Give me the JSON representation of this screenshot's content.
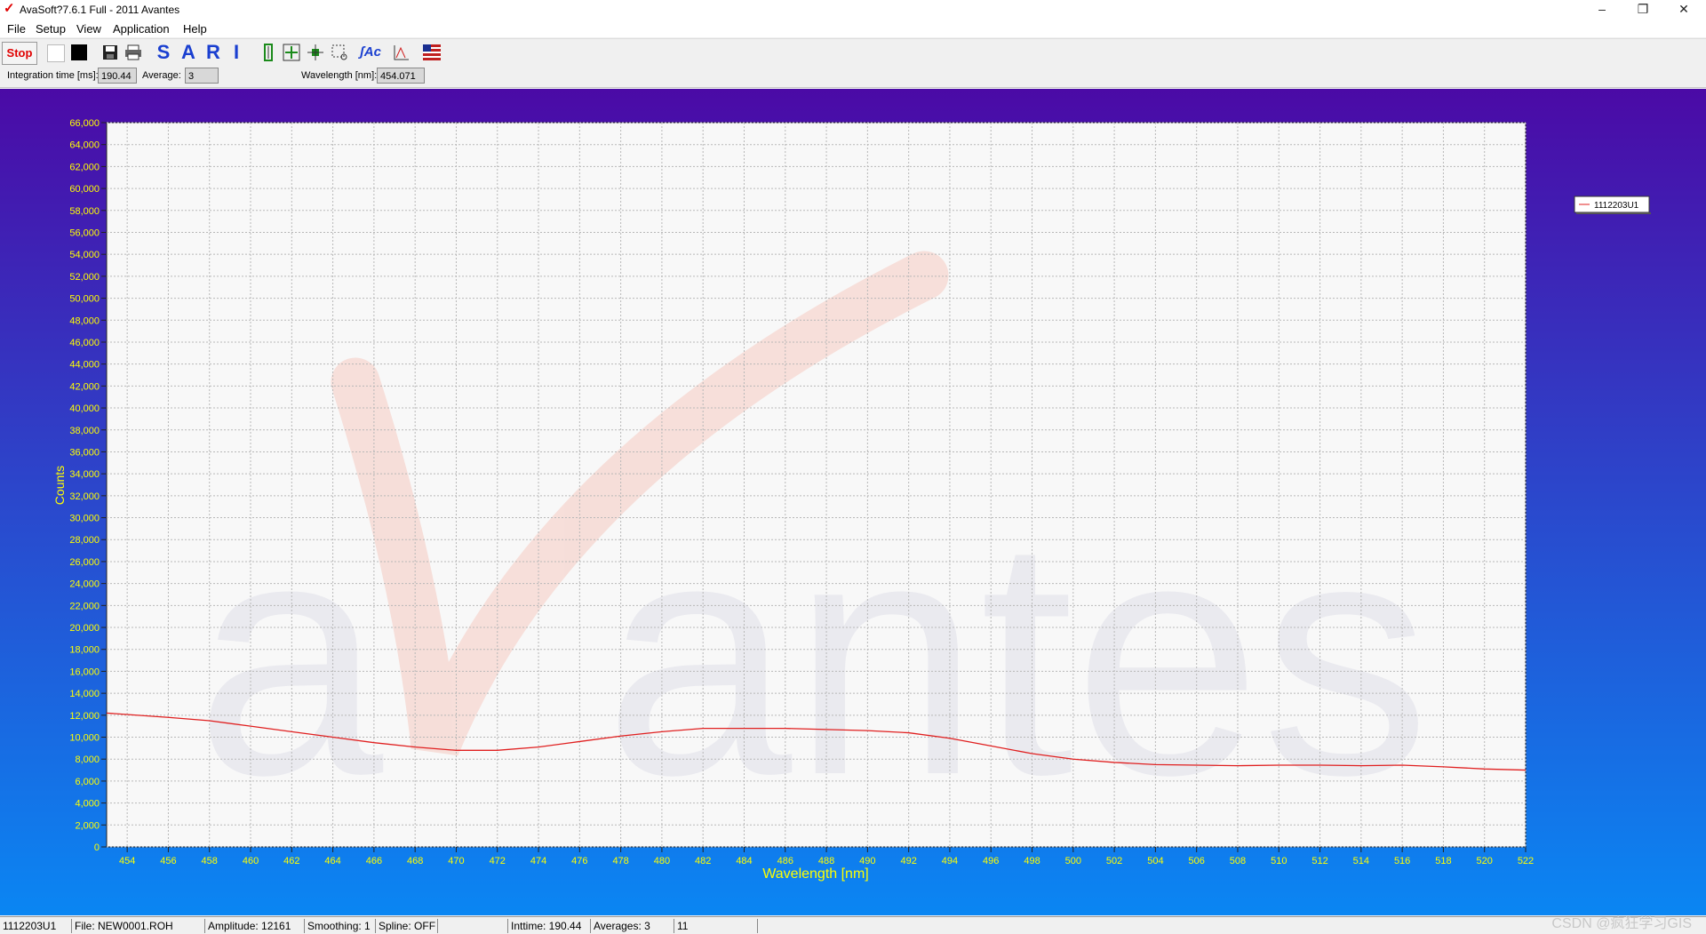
{
  "window": {
    "title": "AvaSoft?7.6.1 Full - 2011 Avantes",
    "minimize": "–",
    "maximize": "❐",
    "close": "✕"
  },
  "menu": [
    "File",
    "Setup",
    "View",
    "Application",
    "Help"
  ],
  "toolbar": {
    "stop_label": "Stop",
    "letters": [
      "S",
      "A",
      "R",
      "I"
    ],
    "icons": [
      "white-box-icon",
      "black-box-icon",
      "save-icon",
      "print-icon",
      "scope-mode-s-icon",
      "absorbance-mode-a-icon",
      "reflectance-mode-r-icon",
      "irradiance-mode-i-icon",
      "cursor-icon",
      "autoscale-icon",
      "zoom-icon",
      "zoom-rect-icon",
      "fit-icon",
      "peak-icon",
      "flag-icon"
    ]
  },
  "params": {
    "integration_label": "Integration time [ms]:",
    "integration_value": "190.44",
    "average_label": "Average:",
    "average_value": "3",
    "wavelength_label": "Wavelength [nm]:",
    "wavelength_value": "454.071"
  },
  "colors": {
    "chart_bg_top": "#4b0aa6",
    "chart_bg_bottom": "#0a86f3",
    "plot_bg": "#f8f8f8",
    "series": "#e02020",
    "axis_text": "#ffff00"
  },
  "chart_data": {
    "type": "line",
    "title": "",
    "xlabel": "Wavelength [nm]",
    "ylabel": "Counts",
    "xlim": [
      453,
      522
    ],
    "ylim": [
      0,
      66000
    ],
    "xticks": [
      454,
      456,
      458,
      460,
      462,
      464,
      466,
      468,
      470,
      472,
      474,
      476,
      478,
      480,
      482,
      484,
      486,
      488,
      490,
      492,
      494,
      496,
      498,
      500,
      502,
      504,
      506,
      508,
      510,
      512,
      514,
      516,
      518,
      520,
      522
    ],
    "yticks": [
      0,
      2000,
      4000,
      6000,
      8000,
      10000,
      12000,
      14000,
      16000,
      18000,
      20000,
      22000,
      24000,
      26000,
      28000,
      30000,
      32000,
      34000,
      36000,
      38000,
      40000,
      42000,
      44000,
      46000,
      48000,
      50000,
      52000,
      54000,
      56000,
      58000,
      60000,
      62000,
      64000,
      66000
    ],
    "grid": true,
    "legend_position": "right",
    "series": [
      {
        "name": "1112203U1",
        "x": [
          453,
          456,
          458,
          460,
          462,
          464,
          466,
          468,
          470,
          472,
          474,
          476,
          478,
          480,
          482,
          484,
          486,
          488,
          490,
          492,
          494,
          496,
          498,
          500,
          502,
          504,
          506,
          508,
          510,
          512,
          514,
          516,
          518,
          520,
          522
        ],
        "values": [
          12200,
          11800,
          11500,
          11000,
          10500,
          10000,
          9500,
          9100,
          8800,
          8800,
          9100,
          9600,
          10100,
          10500,
          10800,
          10800,
          10800,
          10700,
          10600,
          10400,
          9900,
          9200,
          8500,
          8000,
          7700,
          7500,
          7450,
          7400,
          7450,
          7450,
          7400,
          7450,
          7300,
          7100,
          7000
        ]
      }
    ]
  },
  "status": {
    "name": "1112203U1",
    "file": "File: NEW0001.ROH",
    "amplitude": "Amplitude: 12161",
    "smoothing": "Smoothing: 1",
    "spline": "Spline: OFF",
    "inttime": "Inttime: 190.44",
    "averages": "Averages: 3",
    "extra": "11"
  },
  "watermark": "CSDN @疯狂学习GIS"
}
